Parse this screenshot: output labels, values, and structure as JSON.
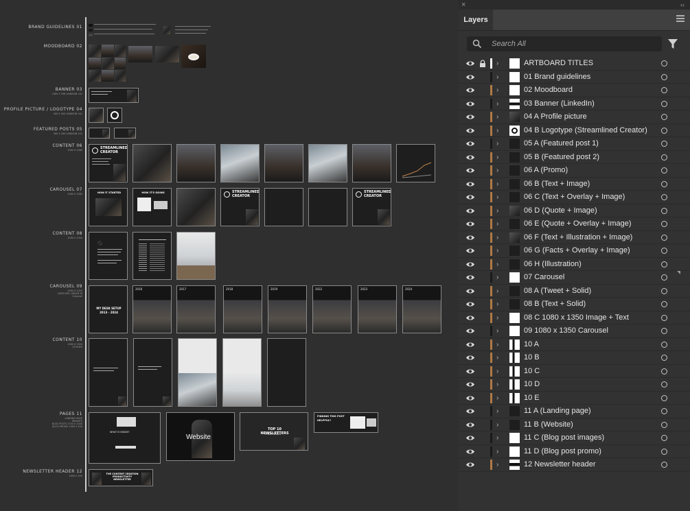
{
  "panel": {
    "close_glyph": "×",
    "collapse_glyph": "‹‹",
    "tab_label": "Layers",
    "search_placeholder": "Search All",
    "icons": {
      "search": "search-icon",
      "filter": "filter-icon",
      "menu": "panel-menu-icon"
    }
  },
  "layers": [
    {
      "name": "ARTBOARD TITLES",
      "locked": true,
      "color": "#ffffff",
      "thumb": "white"
    },
    {
      "name": "01 Brand guidelines",
      "locked": false,
      "color": "#1a1a1a",
      "thumb": "white"
    },
    {
      "name": "02 Moodboard",
      "locked": false,
      "color": "#b07a45",
      "thumb": "white"
    },
    {
      "name": "03 Banner (LinkedIn)",
      "locked": false,
      "color": "#1a1a1a",
      "thumb": "banner"
    },
    {
      "name": "04 A Profile picture",
      "locked": false,
      "color": "#b07a45",
      "thumb": "photo"
    },
    {
      "name": "04 B Logotype (Streamlined Creator)",
      "locked": false,
      "color": "#b07a45",
      "thumb": "logo"
    },
    {
      "name": "05 A (Featured post 1)",
      "locked": false,
      "color": "#1a1a1a",
      "thumb": "dark"
    },
    {
      "name": "05 B (Featured post 2)",
      "locked": false,
      "color": "#b07a45",
      "thumb": "dark"
    },
    {
      "name": "06 A (Promo)",
      "locked": false,
      "color": "#b07a45",
      "thumb": "dark"
    },
    {
      "name": "06 B (Text + Image)",
      "locked": false,
      "color": "#b07a45",
      "thumb": "dark"
    },
    {
      "name": "06 C (Text + Overlay + Image)",
      "locked": false,
      "color": "#b07a45",
      "thumb": "dark"
    },
    {
      "name": "06 D (Quote + Image)",
      "locked": false,
      "color": "#b07a45",
      "thumb": "photo"
    },
    {
      "name": "06 E (Quote + Overlay + Image)",
      "locked": false,
      "color": "#b07a45",
      "thumb": "dark"
    },
    {
      "name": "06 F (Text + Illustration + Image)",
      "locked": false,
      "color": "#b07a45",
      "thumb": "photo"
    },
    {
      "name": "06 G (Facts + Overlay + Image)",
      "locked": false,
      "color": "#b07a45",
      "thumb": "dark"
    },
    {
      "name": "06 H (Illustration)",
      "locked": false,
      "color": "#b07a45",
      "thumb": "dark"
    },
    {
      "name": "07 Carousel",
      "locked": false,
      "color": "#1a1a1a",
      "thumb": "white"
    },
    {
      "name": "08 A (Tweet + Solid)",
      "locked": false,
      "color": "#b07a45",
      "thumb": "dark"
    },
    {
      "name": "08 B (Text + Solid)",
      "locked": false,
      "color": "#b07a45",
      "thumb": "dark"
    },
    {
      "name": "08 C 1080 x 1350 Image + Text",
      "locked": false,
      "color": "#b07a45",
      "thumb": "white"
    },
    {
      "name": "09 1080 x 1350 Carousel",
      "locked": false,
      "color": "#1a1a1a",
      "thumb": "white"
    },
    {
      "name": "10 A",
      "locked": false,
      "color": "#b07a45",
      "thumb": "tall"
    },
    {
      "name": "10 B",
      "locked": false,
      "color": "#b07a45",
      "thumb": "tall"
    },
    {
      "name": "10 C",
      "locked": false,
      "color": "#b07a45",
      "thumb": "tall"
    },
    {
      "name": "10 D",
      "locked": false,
      "color": "#b07a45",
      "thumb": "tall"
    },
    {
      "name": "10 E",
      "locked": false,
      "color": "#b07a45",
      "thumb": "tall"
    },
    {
      "name": "11 A (Landing page)",
      "locked": false,
      "color": "#1a1a1a",
      "thumb": "dark"
    },
    {
      "name": "11 B (Website)",
      "locked": false,
      "color": "#1a1a1a",
      "thumb": "dark"
    },
    {
      "name": "11 C (Blog post images)",
      "locked": false,
      "color": "#1a1a1a",
      "thumb": "white"
    },
    {
      "name": "11 D (Blog post promo)",
      "locked": false,
      "color": "#1a1a1a",
      "thumb": "white"
    },
    {
      "name": "12 Newsletter header",
      "locked": false,
      "color": "#b07a45",
      "thumb": "banner"
    }
  ],
  "artboard_titles": [
    {
      "label": "BRAND GUIDELINES 01",
      "sub": ""
    },
    {
      "label": "MOODBOARD 02",
      "sub": ""
    },
    {
      "label": "BANNER 03",
      "sub": "1584 X 396\nLINKEDIN 1X1"
    },
    {
      "label": "PROFILE PICTURE / LOGOTYPE 04",
      "sub": "400 X 400\nLINKEDIN 1X1"
    },
    {
      "label": "FEATURED POSTS 05",
      "sub": "560 X 280\nLINKEDIN 1X1"
    },
    {
      "label": "CONTENT 06",
      "sub": "1080 X 1080"
    },
    {
      "label": "CAROUSEL 07",
      "sub": "1080 X 1080"
    },
    {
      "label": "CONTENT 08",
      "sub": "1080 X 1350"
    },
    {
      "label": "CAROUSEL 09",
      "sub": "1080 X 1350\nCAROUSEL LINKED IN\nCarousel"
    },
    {
      "label": "CONTENT 10",
      "sub": "1080 X 1920\nSTORIES"
    },
    {
      "label": "PAGES 11",
      "sub": "LANDING PAGE\nWEBSITE\nBLOG POSTS 1700 X 1000\nBLOG PROMO 1000 X 500"
    },
    {
      "label": "NEWSLETTER HEADER 12",
      "sub": "1600 X 500"
    }
  ],
  "artboard_text": {
    "streamlined": "STREAMLINED CREATOR",
    "how_it_started": "HOW IT STARTED",
    "how_its_going": "HOW IT'S GOING",
    "desk_setup": "MY DESK SETUP\n2013 - 2024",
    "years": [
      "2016",
      "2017",
      "2018",
      "2019",
      "2022",
      "2023",
      "2024"
    ],
    "website": "Website",
    "newsletters": "TOP 10 NEWSLETTERS",
    "newsletters_sub": "FROM 2024",
    "finding_post": "FINDING THIS POST HELPFUL?",
    "newsletter_title": "THE CONTENT CREATION PRODUCTIVITY NEWSLETTER",
    "whats_inside": "WHAT IS INSIDE?"
  }
}
